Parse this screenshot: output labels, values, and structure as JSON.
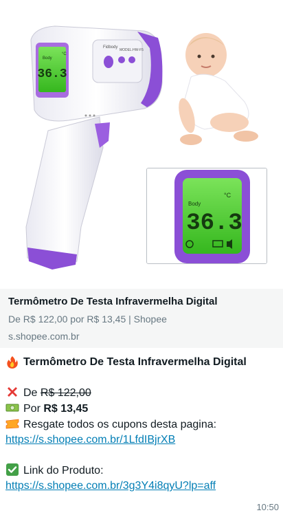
{
  "preview": {
    "title": "Termômetro De Testa Infravermelha Digital",
    "description": "De R$ 122,00 por R$ 13,45 | Shopee",
    "domain": "s.shopee.com.br",
    "device_reading": "36.3",
    "device_body_label": "Body",
    "device_unit": "°C",
    "device_brand": "Fidbody",
    "device_model": "MODEL:HW-F5"
  },
  "message": {
    "headline": "Termômetro De Testa Infravermelha Digital",
    "old_price_prefix": "De ",
    "old_price": "R$ 122,00",
    "new_price_prefix": "Por ",
    "new_price": "R$ 13,45",
    "coupon_text": "Resgate todos os cupons desta pagina:",
    "coupon_link": "https://s.shopee.com.br/1LfdIBjrXB",
    "product_label": "Link do Produto:",
    "product_link": "https://s.shopee.com.br/3g3Y4i8qyU?lp=aff",
    "time": "10:50"
  },
  "icons": {
    "headline": "fire-icon",
    "old_price": "cross-mark-icon",
    "new_price": "money-bill-icon",
    "coupon": "coupon-ticket-icon",
    "product": "check-mark-icon"
  }
}
